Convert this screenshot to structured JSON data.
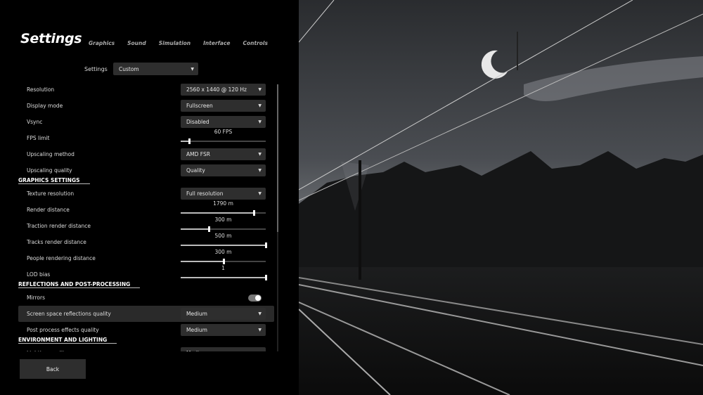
{
  "header": {
    "title": "Settings",
    "tabs": [
      "Graphics",
      "Sound",
      "Simulation",
      "Interface",
      "Controls"
    ]
  },
  "preset": {
    "label": "Settings",
    "value": "Custom"
  },
  "rows": [
    {
      "kind": "dropdown",
      "label": "Resolution",
      "value": "2560 x 1440 @ 120 Hz"
    },
    {
      "kind": "dropdown",
      "label": "Display mode",
      "value": "Fullscreen"
    },
    {
      "kind": "dropdown",
      "label": "Vsync",
      "value": "Disabled"
    },
    {
      "kind": "slider",
      "label": "FPS limit",
      "value": "60 FPS",
      "fraction": 0.1
    },
    {
      "kind": "dropdown",
      "label": "Upscaling method",
      "value": "AMD FSR"
    },
    {
      "kind": "dropdown",
      "label": "Upscaling quality",
      "value": "Quality"
    },
    {
      "kind": "section",
      "label": "GRAPHICS SETTINGS"
    },
    {
      "kind": "dropdown",
      "label": "Texture resolution",
      "value": "Full resolution"
    },
    {
      "kind": "slider",
      "label": "Render distance",
      "value": "1790 m",
      "fraction": 0.86
    },
    {
      "kind": "slider",
      "label": "Traction render distance",
      "value": "300 m",
      "fraction": 0.33
    },
    {
      "kind": "slider",
      "label": "Tracks render distance",
      "value": "500 m",
      "fraction": 1.0
    },
    {
      "kind": "slider",
      "label": "People rendering distance",
      "value": "300 m",
      "fraction": 0.5
    },
    {
      "kind": "slider",
      "label": "LOD bias",
      "value": "1",
      "fraction": 1.0
    },
    {
      "kind": "section",
      "label": "REFLECTIONS AND POST-PROCESSING"
    },
    {
      "kind": "toggle",
      "label": "Mirrors",
      "on": true
    },
    {
      "kind": "dropdown",
      "label": "Screen space reflections quality",
      "value": "Medium",
      "highlighted": true
    },
    {
      "kind": "dropdown",
      "label": "Post process effects quality",
      "value": "Medium"
    },
    {
      "kind": "section",
      "label": "ENVIRONMENT AND LIGHTING"
    },
    {
      "kind": "dropdown",
      "label": "Lighting quality",
      "value": "Medium"
    }
  ],
  "back_label": "Back",
  "colors": {
    "panel": "#000000",
    "control": "#2e2e2e",
    "highlight": "#2a2a2a"
  }
}
